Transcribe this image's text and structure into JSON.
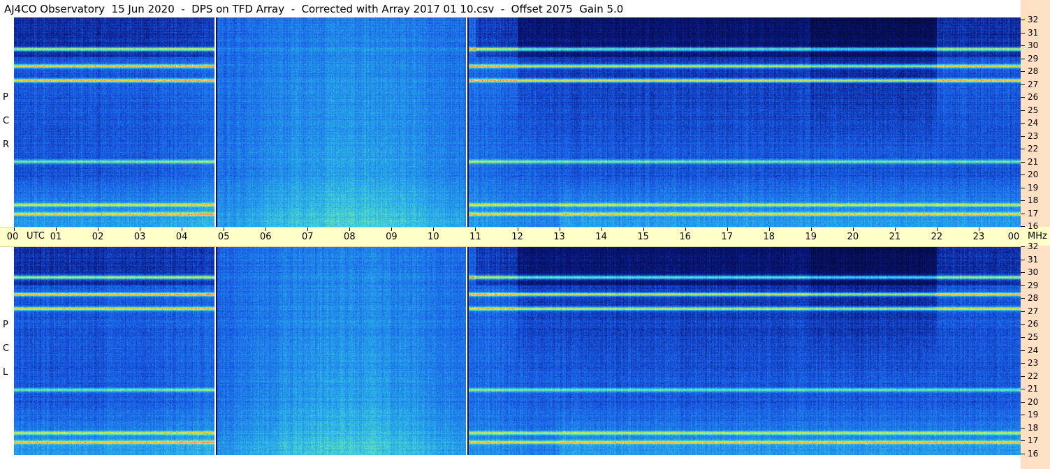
{
  "title": "AJ4CO Observatory  15 Jun 2020  -  DPS on TFD Array  -  Corrected with Array 2017 01 10.csv  -  Offset 2075  Gain 5.0",
  "panels": [
    {
      "id": "rcp",
      "label": [
        "R",
        "C",
        "P"
      ]
    },
    {
      "id": "lcp",
      "label": [
        "L",
        "C",
        "P"
      ]
    }
  ],
  "time_axis": {
    "ticks": [
      "00",
      "01",
      "02",
      "03",
      "04",
      "05",
      "06",
      "07",
      "08",
      "09",
      "10",
      "11",
      "12",
      "13",
      "14",
      "15",
      "16",
      "17",
      "18",
      "19",
      "20",
      "21",
      "22",
      "23",
      "00"
    ],
    "unit": "UTC"
  },
  "freq_axis": {
    "ticks": [
      "32",
      "31",
      "30",
      "29",
      "28",
      "27",
      "26",
      "25",
      "24",
      "23",
      "22",
      "21",
      "20",
      "19",
      "18",
      "17",
      "16"
    ],
    "unit": "MHz"
  },
  "colors": {
    "background_low": "#0a1a80",
    "mid": "#1a5ee6",
    "high": "#30d0e0",
    "hot": "#f0f040",
    "peak": "#ff40a0",
    "time_axis_bg": "#ffffc8",
    "freq_axis_bg": "#ffe0c4"
  },
  "chart_data": {
    "type": "heatmap",
    "title": "AJ4CO Observatory  15 Jun 2020  -  DPS on TFD Array  -  Corrected with Array 2017 01 10.csv  -  Offset 2075  Gain 5.0",
    "x": {
      "label": "UTC",
      "range_hours": [
        0,
        24
      ]
    },
    "y": {
      "label": "MHz",
      "range": [
        16,
        32
      ]
    },
    "series": [
      {
        "name": "RCP",
        "description_values": {
          "strong_bands_mhz": [
            27.2,
            28.3,
            29.6,
            21.0,
            17.7,
            17.0
          ],
          "calibration_markers_utc": [
            4.8,
            10.8
          ]
        }
      },
      {
        "name": "LCP",
        "description_values": {
          "strong_bands_mhz": [
            27.2,
            28.3,
            29.6,
            21.0,
            17.7,
            17.0
          ],
          "calibration_markers_utc": [
            4.8,
            10.8
          ]
        }
      }
    ]
  }
}
